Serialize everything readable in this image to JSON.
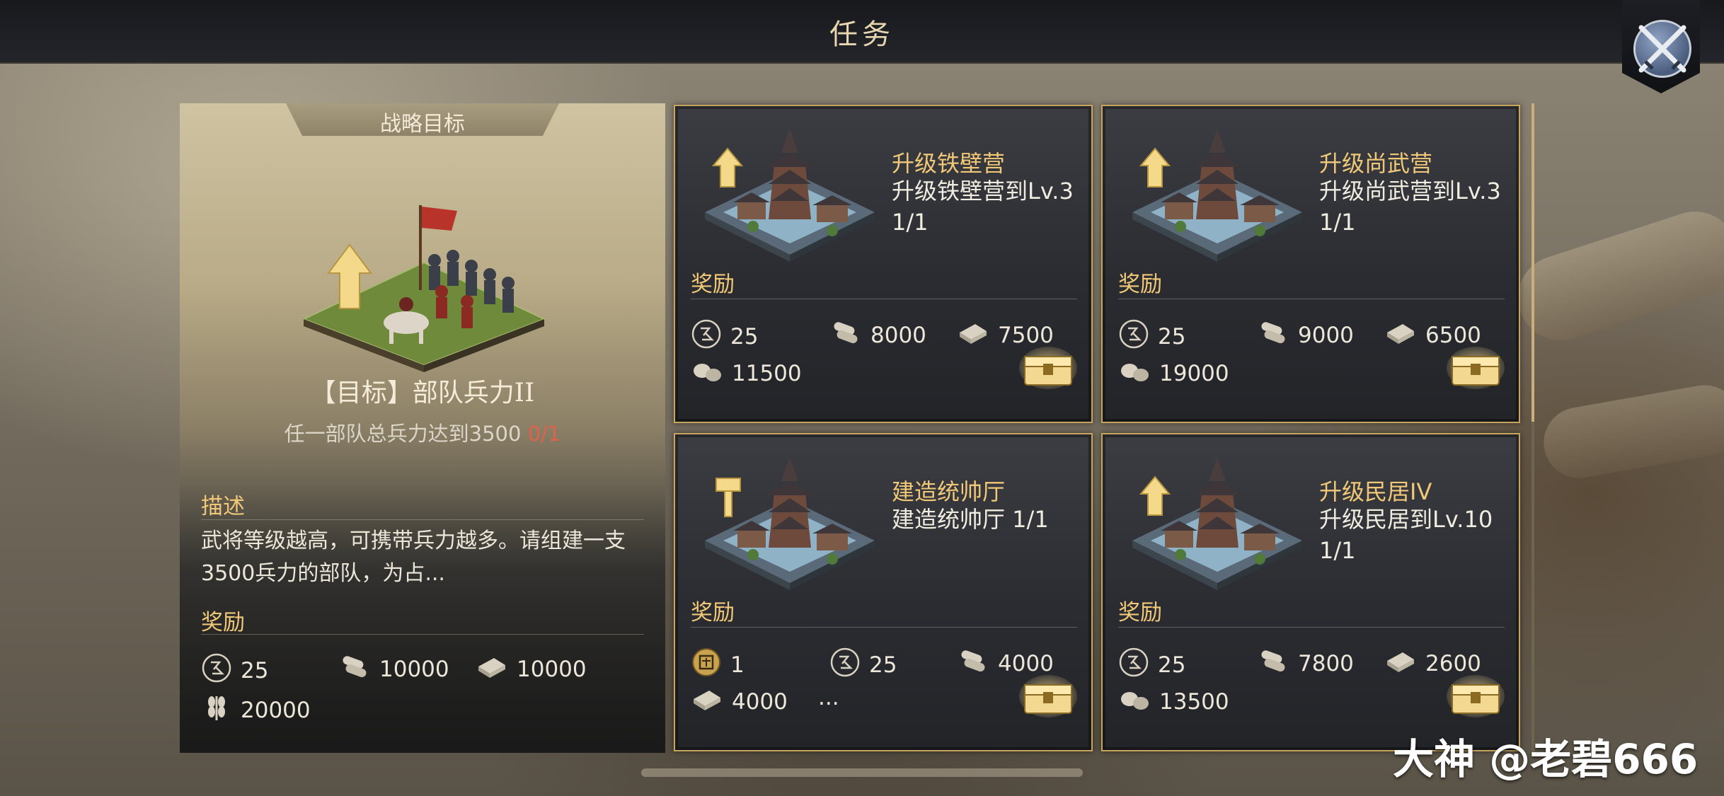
{
  "header": {
    "title": "任务"
  },
  "left_panel": {
    "tab_label": "战略目标",
    "goal_title": "【目标】部队兵力II",
    "goal_desc": "任一部队总兵力达到3500",
    "goal_progress": "0/1",
    "desc_label": "描述",
    "desc_text": "武将等级越高，可携带兵力越多。请组建一支3500兵力的部队，为占...",
    "reward_label": "奖励",
    "rewards": [
      {
        "icon": "fame-icon",
        "value": "25"
      },
      {
        "icon": "wood-icon",
        "value": "10000"
      },
      {
        "icon": "iron-icon",
        "value": "10000"
      },
      {
        "icon": "grain-icon",
        "value": "20000"
      }
    ]
  },
  "quests": [
    {
      "name": "升级铁壁营",
      "desc": "升级铁壁营到Lv.3",
      "progress": "1/1",
      "reward_label": "奖励",
      "building_badge": "upgrade-arrow-icon",
      "rewards": [
        {
          "icon": "fame-icon",
          "value": "25"
        },
        {
          "icon": "wood-icon",
          "value": "8000"
        },
        {
          "icon": "iron-icon",
          "value": "7500"
        },
        {
          "icon": "stone-icon",
          "value": "11500"
        }
      ]
    },
    {
      "name": "升级尚武营",
      "desc": "升级尚武营到Lv.3",
      "progress": "1/1",
      "reward_label": "奖励",
      "building_badge": "upgrade-arrow-icon",
      "rewards": [
        {
          "icon": "fame-icon",
          "value": "25"
        },
        {
          "icon": "wood-icon",
          "value": "9000"
        },
        {
          "icon": "iron-icon",
          "value": "6500"
        },
        {
          "icon": "stone-icon",
          "value": "19000"
        }
      ]
    },
    {
      "name": "建造统帅厅",
      "desc": "建造统帅厅 1/1",
      "progress": "",
      "reward_label": "奖励",
      "building_badge": "hammer-icon",
      "rewards": [
        {
          "icon": "seal-icon",
          "value": "1"
        },
        {
          "icon": "fame-icon",
          "value": "25"
        },
        {
          "icon": "wood-icon",
          "value": "4000"
        },
        {
          "icon": "iron-icon",
          "value": "4000"
        },
        {
          "icon": "more-icon",
          "value": "..."
        }
      ]
    },
    {
      "name": "升级民居IV",
      "desc": "升级民居到Lv.10",
      "progress": "1/1",
      "reward_label": "奖励",
      "building_badge": "upgrade-arrow-icon",
      "rewards": [
        {
          "icon": "fame-icon",
          "value": "25"
        },
        {
          "icon": "wood-icon",
          "value": "7800"
        },
        {
          "icon": "iron-icon",
          "value": "2600"
        },
        {
          "icon": "stone-icon",
          "value": "13500"
        }
      ]
    }
  ],
  "watermark": "大神 @老碧666",
  "colors": {
    "gold": "#f0c878",
    "card_border": "#c7a55c",
    "progress_red": "#e0624a"
  }
}
